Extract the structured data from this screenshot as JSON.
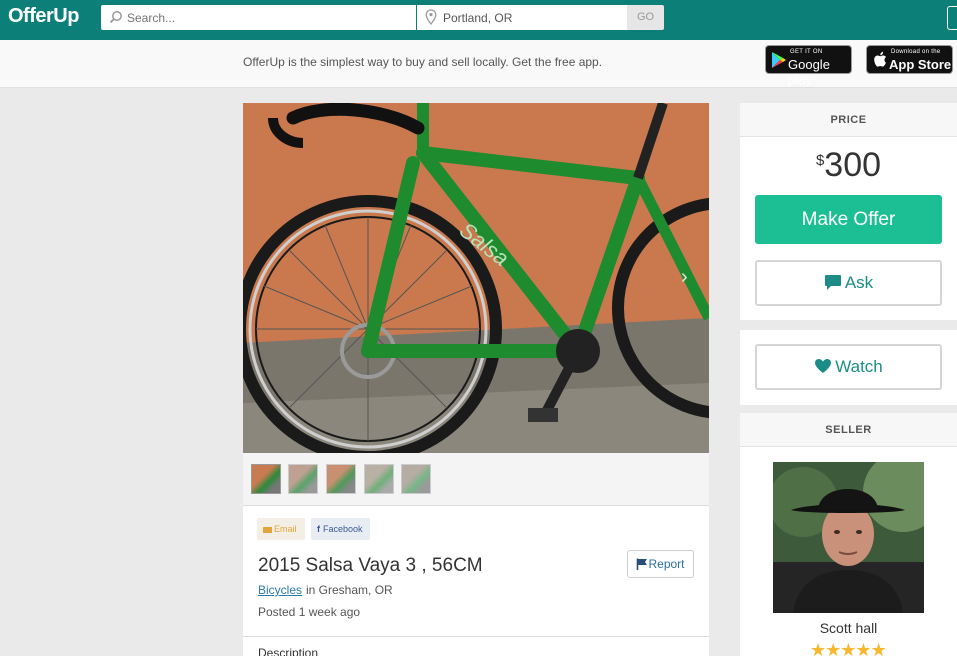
{
  "header": {
    "logo": "OfferUp",
    "search_placeholder": "Search...",
    "location_value": "Portland, OR",
    "go_label": "GO"
  },
  "promo": {
    "text": "OfferUp is the simplest way to buy and sell locally. Get the free app.",
    "google_play_small": "GET IT ON",
    "google_play_big": "Google play",
    "app_store_small": "Download on the",
    "app_store_big": "App Store"
  },
  "listing": {
    "share_email": "Email",
    "share_facebook": "Facebook",
    "title": "2015 Salsa Vaya 3 , 56CM",
    "report_label": "Report",
    "category": "Bicycles",
    "location": "in Gresham, OR",
    "posted": "Posted 1 week ago",
    "description_label": "Description"
  },
  "sidebar": {
    "price_header": "PRICE",
    "currency": "$",
    "price": "300",
    "make_offer_label": "Make Offer",
    "ask_label": "Ask",
    "watch_label": "Watch",
    "seller_header": "SELLER",
    "seller_name": "Scott hall",
    "seller_rating_stars": 5
  },
  "colors": {
    "brand_teal": "#0b7f78",
    "offer_green": "#1cbf93",
    "action_teal": "#1b8d86",
    "star_gold": "#f5b82e"
  },
  "icons": [
    "search-icon",
    "location-pin-icon",
    "play-store-icon",
    "apple-icon",
    "chevron-right-icon",
    "email-icon",
    "facebook-icon",
    "flag-icon",
    "chat-bubble-icon",
    "heart-icon",
    "star-icon"
  ]
}
